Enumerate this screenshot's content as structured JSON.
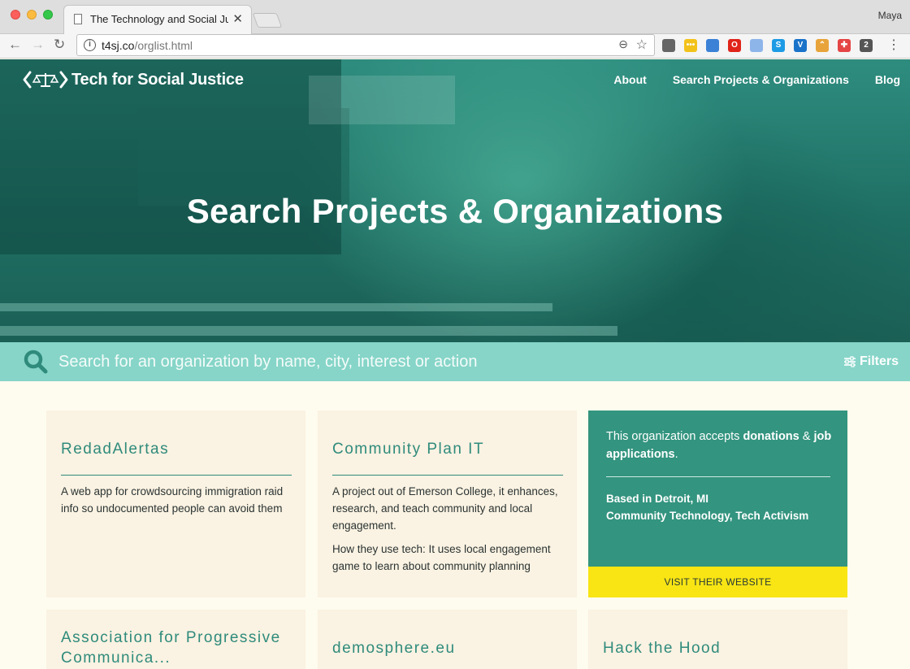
{
  "browser": {
    "tab_title": "The Technology and Social Justice",
    "tab_close": "✕",
    "profile_name": "Maya",
    "url_host": "t4sj.co",
    "url_path": "/orglist.html",
    "back": "←",
    "forward": "→",
    "reload": "↻",
    "zoom": "⊖",
    "star": "☆",
    "menu": "⋮",
    "extensions": [
      {
        "name": "cast-icon",
        "color": "#666666",
        "glyph": ""
      },
      {
        "name": "notes-extension-icon",
        "color": "#f3c21a",
        "glyph": "•••"
      },
      {
        "name": "stack-extension-icon",
        "color": "#3b82d6",
        "glyph": ""
      },
      {
        "name": "opera-icon",
        "color": "#e0241a",
        "glyph": "O"
      },
      {
        "name": "docs-extension-icon",
        "color": "#8db5ea",
        "glyph": ""
      },
      {
        "name": "skype-icon",
        "color": "#1e9be5",
        "glyph": "S"
      },
      {
        "name": "vimeo-extension-icon",
        "color": "#1a73c9",
        "glyph": "V"
      },
      {
        "name": "rainbow-extension-icon",
        "color": "#e8a43a",
        "glyph": "⌃"
      },
      {
        "name": "cross-extension-icon",
        "color": "#e54545",
        "glyph": "✚"
      },
      {
        "name": "pen-extension-icon",
        "color": "#555555",
        "glyph": "2"
      }
    ]
  },
  "site": {
    "logo_text": "Tech for Social Justice",
    "nav": [
      "About",
      "Search Projects & Organizations",
      "Blog"
    ],
    "hero_title": "Search Projects & Organizations"
  },
  "search": {
    "placeholder": "Search for an organization by name, city, interest or action",
    "filters_label": "Filters"
  },
  "cards": [
    {
      "title": "RedadAlertas",
      "paragraphs": [
        "A web app for crowdsourcing immigration raid info so undocumented people can avoid them"
      ]
    },
    {
      "title": "Community Plan IT",
      "paragraphs": [
        "A project out of Emerson College, it enhances, research, and teach community and local engagement.",
        "How they use tech: It uses local engagement game to learn about community planning"
      ]
    },
    {
      "title": "Association for Progressive Communica..."
    },
    {
      "title": "demosphere.eu"
    },
    {
      "title": "Hack the Hood"
    }
  ],
  "highlight_card": {
    "accepts_prefix": "This organization accepts ",
    "accepts_bold_1": "donations",
    "accepts_and": " & ",
    "accepts_bold_2": "job applications",
    "accepts_suffix": ".",
    "location": "Based in Detroit, MI",
    "interests": "Community Technology, Tech Activism",
    "visit_label": "VISIT THEIR WEBSITE"
  },
  "colors": {
    "teal": "#2f8b7c",
    "search_bar": "#86d5c8",
    "card_bg": "#faf2e2",
    "highlight_bg": "#33947f",
    "visit_button": "#f8e513"
  }
}
